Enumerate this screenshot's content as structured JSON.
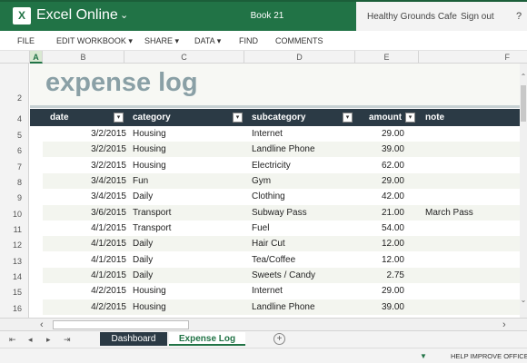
{
  "app": {
    "logo_letter": "X",
    "name": "Excel Online",
    "workbook_name": "Book 21",
    "user_name": "Healthy Grounds Cafe",
    "sign_out": "Sign out",
    "help": "?"
  },
  "menu": [
    "FILE",
    "EDIT WORKBOOK",
    "SHARE",
    "DATA",
    "FIND",
    "COMMENTS"
  ],
  "columns": [
    "A",
    "B",
    "C",
    "D",
    "E",
    "F"
  ],
  "row_numbers": [
    "2",
    "4",
    "5",
    "6",
    "7",
    "8",
    "9",
    "10",
    "11",
    "12",
    "13",
    "14",
    "15",
    "16"
  ],
  "sheet_title": "expense log",
  "table": {
    "headers": [
      "date",
      "category",
      "subcategory",
      "amount",
      "note"
    ],
    "rows": [
      [
        "3/2/2015",
        "Housing",
        "Internet",
        "29.00",
        ""
      ],
      [
        "3/2/2015",
        "Housing",
        "Landline Phone",
        "39.00",
        ""
      ],
      [
        "3/2/2015",
        "Housing",
        "Electricity",
        "62.00",
        ""
      ],
      [
        "3/4/2015",
        "Fun",
        "Gym",
        "29.00",
        ""
      ],
      [
        "3/4/2015",
        "Daily",
        "Clothing",
        "42.00",
        ""
      ],
      [
        "3/6/2015",
        "Transport",
        "Subway Pass",
        "21.00",
        "March Pass"
      ],
      [
        "4/1/2015",
        "Transport",
        "Fuel",
        "54.00",
        ""
      ],
      [
        "4/1/2015",
        "Daily",
        "Hair Cut",
        "12.00",
        ""
      ],
      [
        "4/1/2015",
        "Daily",
        "Tea/Coffee",
        "12.00",
        ""
      ],
      [
        "4/1/2015",
        "Daily",
        "Sweets / Candy",
        "2.75",
        ""
      ],
      [
        "4/2/2015",
        "Housing",
        "Internet",
        "29.00",
        ""
      ],
      [
        "4/2/2015",
        "Housing",
        "Landline Phone",
        "39.00",
        ""
      ]
    ]
  },
  "sheets": {
    "tabs": [
      "Dashboard",
      "Expense Log"
    ],
    "active": "Expense Log"
  },
  "status": {
    "help_improve": "HELP IMPROVE OFFICE"
  },
  "colors": {
    "excel_green": "#217346",
    "header_dark": "#2b3a45",
    "title_color": "#8aa0a6"
  }
}
